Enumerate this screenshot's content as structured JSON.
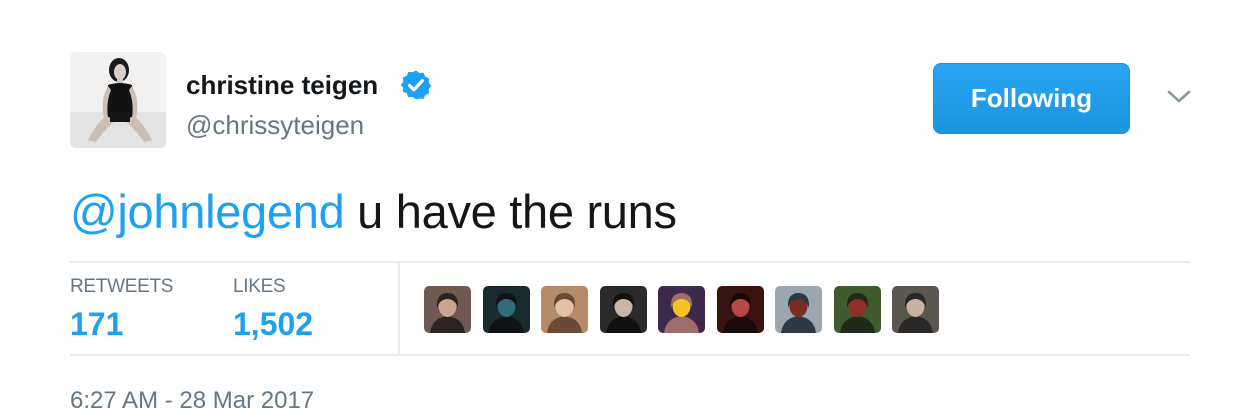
{
  "user": {
    "display_name": "christine teigen",
    "handle": "@chrissyteigen",
    "verified": true,
    "avatar_icon": "profile-photo"
  },
  "follow_button": {
    "label": "Following"
  },
  "menu_icon": "chevron-down-icon",
  "tweet": {
    "mention": "@johnlegend",
    "text": " u have the runs"
  },
  "stats": {
    "retweets_label": "RETWEETS",
    "retweets_count": "171",
    "likes_label": "LIKES",
    "likes_count": "1,502"
  },
  "likers": [
    {
      "name": "liker-avatar-1",
      "colors": [
        "#6e5a52",
        "#c9a48f",
        "#2b2421"
      ]
    },
    {
      "name": "liker-avatar-2",
      "colors": [
        "#1b2a2e",
        "#2f6e78",
        "#0f1416"
      ]
    },
    {
      "name": "liker-avatar-3",
      "colors": [
        "#b58a68",
        "#e1c2a4",
        "#6a4a33"
      ]
    },
    {
      "name": "liker-avatar-4",
      "colors": [
        "#2a2a2a",
        "#c8b7a5",
        "#111111"
      ]
    },
    {
      "name": "liker-avatar-5",
      "colors": [
        "#3b2a4c",
        "#f3c524",
        "#a06d6b"
      ]
    },
    {
      "name": "liker-avatar-6",
      "colors": [
        "#3a1412",
        "#b8474a",
        "#1a0b0a"
      ]
    },
    {
      "name": "liker-avatar-7",
      "colors": [
        "#9aa6b0",
        "#7a2b26",
        "#2e3a41"
      ]
    },
    {
      "name": "liker-avatar-8",
      "colors": [
        "#3f5a2c",
        "#8f2f2a",
        "#1f2a18"
      ]
    },
    {
      "name": "liker-avatar-9",
      "colors": [
        "#5a5750",
        "#c7b2a4",
        "#2a2826"
      ]
    }
  ],
  "timestamp": "6:27 AM - 28 Mar 2017",
  "colors": {
    "accent": "#1da1f2",
    "muted": "#657786",
    "text": "#14171a",
    "divider": "#e6ecf0"
  }
}
